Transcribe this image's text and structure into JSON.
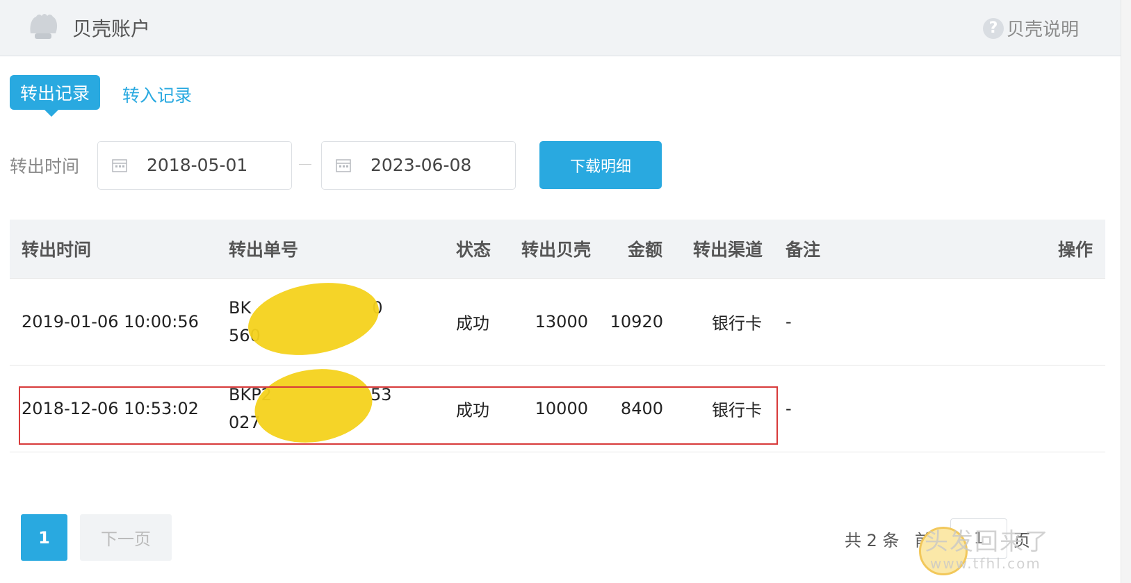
{
  "header": {
    "title": "贝壳账户",
    "help_label": "贝壳说明",
    "help_icon": "question-circle-icon",
    "logo_icon": "shell-logo-icon"
  },
  "tabs": [
    {
      "label": "转出记录",
      "active": true
    },
    {
      "label": "转入记录",
      "active": false
    }
  ],
  "filter": {
    "label": "转出时间",
    "start_date": "2018-05-01",
    "end_date": "2023-06-08",
    "download_label": "下载明细"
  },
  "table": {
    "headers": [
      "转出时间",
      "转出单号",
      "状态",
      "转出贝壳",
      "金额",
      "转出渠道",
      "备注",
      "操作"
    ],
    "rows": [
      {
        "time": "2019-01-06 10:00:56",
        "order_line1": "BK",
        "order_line1_tail": "0",
        "order_line2": "560",
        "status": "成功",
        "shells": "13000",
        "amount": "10920",
        "channel": "银行卡",
        "remark": "-"
      },
      {
        "time": "2018-12-06 10:53:02",
        "order_line1": "BKP2",
        "order_line1_tail": "53",
        "order_line2": "027",
        "status": "成功",
        "shells": "10000",
        "amount": "8400",
        "channel": "银行卡",
        "remark": "-"
      }
    ]
  },
  "pagination": {
    "current_page": "1",
    "next_label": "下一页",
    "total_label": "共 2 条",
    "goto_label": "前往",
    "goto_value": "1",
    "page_suffix": "页"
  },
  "watermark": {
    "text": "头发回来了",
    "url": "www.tfhl.com"
  },
  "colors": {
    "accent": "#29a9e0",
    "highlight_box": "#d83a3a",
    "redaction": "#f4d21c"
  }
}
